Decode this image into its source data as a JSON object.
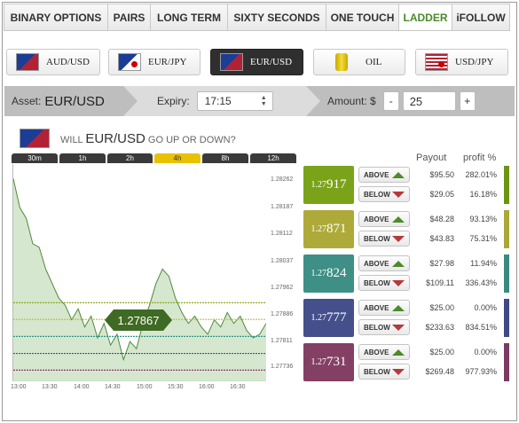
{
  "tabs": [
    {
      "label": "BINARY OPTIONS",
      "active": false
    },
    {
      "label": "PAIRS",
      "active": false
    },
    {
      "label": "LONG TERM",
      "active": false
    },
    {
      "label": "SIXTY SECONDS",
      "active": false
    },
    {
      "label": "ONE TOUCH",
      "active": false
    },
    {
      "label": "LADDER",
      "active": true
    },
    {
      "label": "iFOLLOW",
      "active": false
    }
  ],
  "assets": [
    {
      "label": "AUD/USD",
      "icon": "aud-usd-flag-icon"
    },
    {
      "label": "EUR/JPY",
      "icon": "eur-jpy-flag-icon"
    },
    {
      "label": "EUR/USD",
      "icon": "eur-usd-flag-icon",
      "active": true
    },
    {
      "label": "OIL",
      "icon": "oil-barrel-icon"
    },
    {
      "label": "USD/JPY",
      "icon": "usd-jpy-flag-icon"
    }
  ],
  "settings": {
    "asset_label": "Asset:",
    "asset_value": "EUR/USD",
    "expiry_label": "Expiry:",
    "expiry_value": "17:15",
    "amount_label": "Amount: $",
    "amount_value": "25",
    "minus": "-",
    "plus": "+"
  },
  "question": {
    "prefix": "WILL",
    "asset": "EUR/USD",
    "suffix": "GO UP OR DOWN?"
  },
  "timeframes": [
    {
      "label": "30m"
    },
    {
      "label": "1h"
    },
    {
      "label": "2h"
    },
    {
      "label": "4h",
      "active": true
    },
    {
      "label": "8h"
    },
    {
      "label": "12h"
    }
  ],
  "chart_data": {
    "type": "area",
    "x_labels": [
      "13:00",
      "13:30",
      "14:00",
      "14:30",
      "15:00",
      "15:30",
      "16:00",
      "16:30"
    ],
    "y_labels": [
      "1.28262",
      "1.28187",
      "1.28112",
      "1.28037",
      "1.27962",
      "1.27886",
      "1.27811",
      "1.27736"
    ],
    "ylim": [
      1.277,
      1.283
    ],
    "current_price": "1.27867",
    "series": [
      {
        "values": [
          1.2826,
          1.2818,
          1.2815,
          1.2808,
          1.2807,
          1.2801,
          1.2797,
          1.2793,
          1.2791,
          1.2787,
          1.279,
          1.2785,
          1.2788,
          1.2782,
          1.2786,
          1.278,
          1.2783,
          1.2776,
          1.2781,
          1.2779,
          1.2786,
          1.2791,
          1.2797,
          1.2801,
          1.2799,
          1.2793,
          1.2789,
          1.2786,
          1.2788,
          1.2785,
          1.2783,
          1.2787,
          1.2785,
          1.2789,
          1.2786,
          1.2788,
          1.2784,
          1.2782,
          1.2783,
          1.2786
        ]
      }
    ],
    "levels": [
      {
        "price": 1.27917,
        "color": "#8cad1e"
      },
      {
        "price": 1.27871,
        "color": "#c2bb33"
      },
      {
        "price": 1.27824,
        "color": "#2f9688"
      },
      {
        "price": 1.27777,
        "color": "#3f51a0"
      },
      {
        "price": 1.27731,
        "color": "#8e3a6a"
      }
    ]
  },
  "ladder": {
    "payout_header": "Payout",
    "profit_header": "profit %",
    "rows": [
      {
        "prefix": "1.27",
        "digits": "917",
        "color": "#7ba31a",
        "side_color": "#6b9412",
        "above": {
          "label": "ABOVE",
          "payout": "$95.50",
          "profit": "282.01%"
        },
        "below": {
          "label": "BELOW",
          "payout": "$29.05",
          "profit": "16.18%"
        }
      },
      {
        "prefix": "1.27",
        "digits": "871",
        "color": "#aeaa3a",
        "side_color": "#a9a838",
        "above": {
          "label": "ABOVE",
          "payout": "$48.28",
          "profit": "93.13%"
        },
        "below": {
          "label": "BELOW",
          "payout": "$43.83",
          "profit": "75.31%"
        }
      },
      {
        "prefix": "1.27",
        "digits": "824",
        "color": "#3e8f86",
        "side_color": "#3a8a80",
        "above": {
          "label": "ABOVE",
          "payout": "$27.98",
          "profit": "11.94%"
        },
        "below": {
          "label": "BELOW",
          "payout": "$109.11",
          "profit": "336.43%"
        }
      },
      {
        "prefix": "1.27",
        "digits": "777",
        "color": "#454f8c",
        "side_color": "#3f4986",
        "above": {
          "label": "ABOVE",
          "payout": "$25.00",
          "profit": "0.00%"
        },
        "below": {
          "label": "BELOW",
          "payout": "$233.63",
          "profit": "834.51%"
        }
      },
      {
        "prefix": "1.27",
        "digits": "731",
        "color": "#844064",
        "side_color": "#7d3a5f",
        "above": {
          "label": "ABOVE",
          "payout": "$25.00",
          "profit": "0.00%"
        },
        "below": {
          "label": "BELOW",
          "payout": "$269.48",
          "profit": "977.93%"
        }
      }
    ]
  }
}
